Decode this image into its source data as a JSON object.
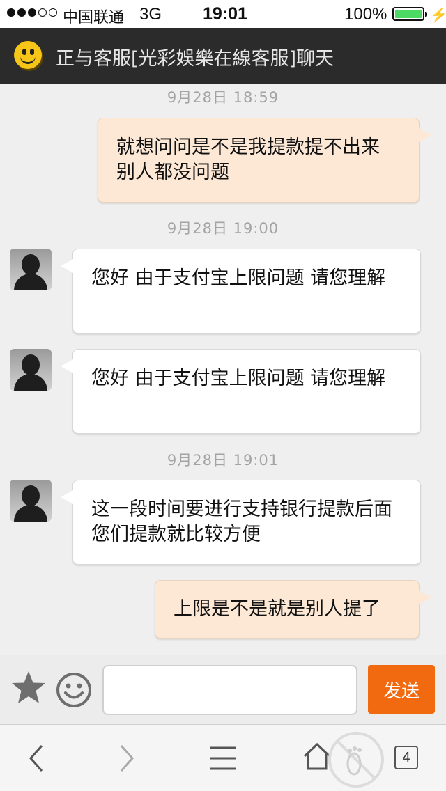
{
  "status_bar": {
    "carrier": "中国联通",
    "network": "3G",
    "time": "19:01",
    "battery": "100%",
    "battery_color": "#4cd964"
  },
  "header": {
    "title": "正与客服[光彩娛樂在線客服]聊天",
    "icon": "smiley-icon"
  },
  "messages": [
    {
      "type": "timestamp",
      "text": "9月28日 18:59"
    },
    {
      "type": "outgoing",
      "text": "就想问问是不是我提款提不出来 别人都没问题"
    },
    {
      "type": "timestamp",
      "text": "9月28日 19:00"
    },
    {
      "type": "incoming",
      "text": "您好 由于支付宝上限问题 请您理解"
    },
    {
      "type": "incoming",
      "text": "您好 由于支付宝上限问题 请您理解"
    },
    {
      "type": "timestamp",
      "text": "9月28日 19:01"
    },
    {
      "type": "incoming",
      "text": "这一段时间要进行支持银行提款后面您们提款就比较方便"
    },
    {
      "type": "outgoing",
      "text": "上限是不是就是别人提了"
    }
  ],
  "input_bar": {
    "favorite_icon": "star-icon",
    "emoji_icon": "smile-icon",
    "input_value": "",
    "send_label": "发送",
    "send_color": "#f26a0f"
  },
  "browser_toolbar": {
    "icons": [
      "back-icon",
      "forward-icon",
      "menu-icon",
      "home-icon",
      "footprint-icon"
    ],
    "tab_count": "4"
  }
}
